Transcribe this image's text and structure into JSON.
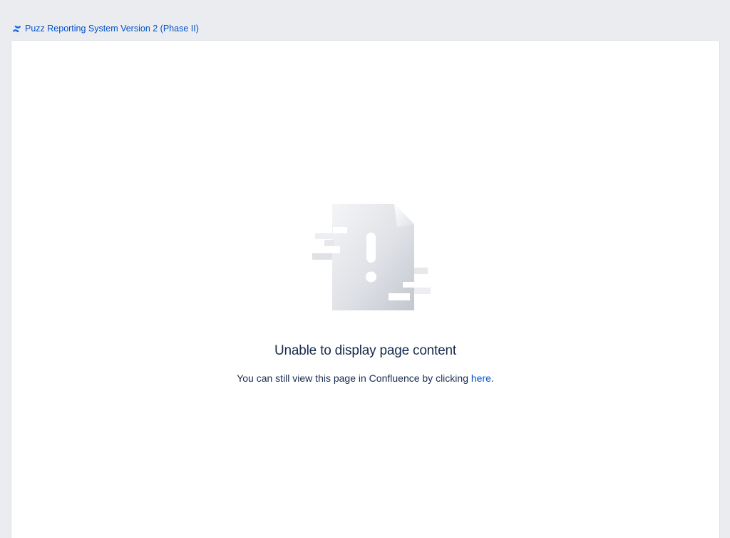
{
  "header": {
    "icon": "confluence-logo-icon",
    "title": "Puzz Reporting System Version 2 (Phase II)",
    "link_color": "#0052cc"
  },
  "main": {
    "illustration_icon": "broken-page-warning-icon",
    "heading": "Unable to display page content",
    "message_before": "You can still view this page in Confluence by clicking ",
    "link_label": "here",
    "message_after": "."
  },
  "colors": {
    "background": "#ebecf0",
    "card": "#ffffff",
    "text": "#172b4d",
    "link": "#0052cc"
  }
}
